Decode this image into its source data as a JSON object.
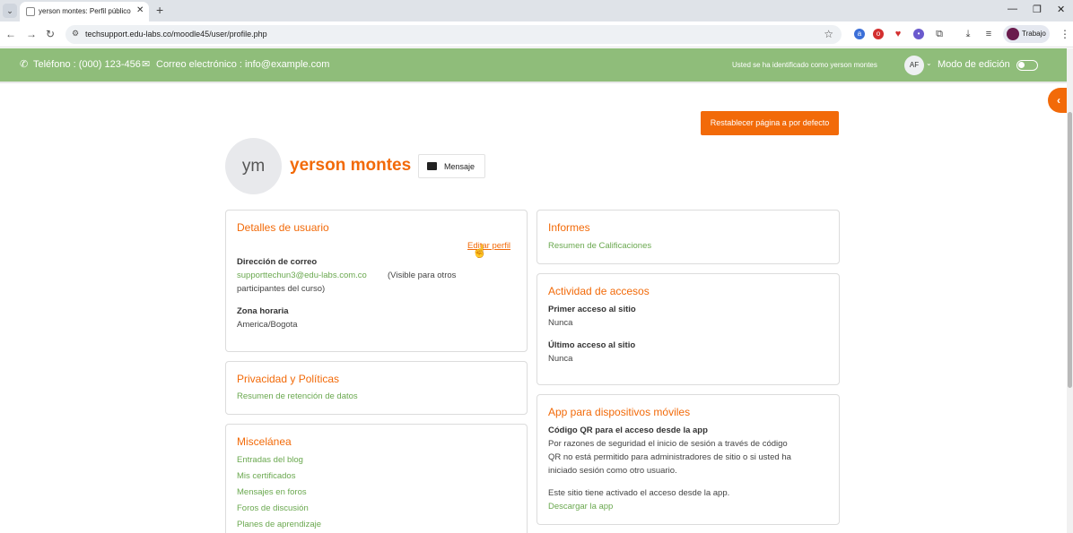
{
  "browser": {
    "tab_title": "yerson montes: Perfil público | T",
    "url": "techsupport.edu-labs.co/moodle45/user/profile.php",
    "profile_label": "Trabajo"
  },
  "header": {
    "phone": "Teléfono : (000) 123-456",
    "email": "Correo electrónico : info@example.com",
    "login_info": "Usted se ha identificado como yerson montes",
    "user_initials": "AF",
    "edit_mode_label": "Modo de edición"
  },
  "page": {
    "reset_button": "Restablecer página a por defecto",
    "avatar_initials": "ym",
    "profile_name": "yerson montes",
    "message_button": "Mensaje"
  },
  "user_details": {
    "title": "Detalles de usuario",
    "edit_link": "Editar perfil",
    "email_label": "Dirección de correo",
    "email_value": "supporttechun3@edu-labs.com.co",
    "email_note_line1": "(Visible para otros",
    "email_note_line2": "participantes del curso)",
    "timezone_label": "Zona horaria",
    "timezone_value": "America/Bogota"
  },
  "privacy": {
    "title": "Privacidad y Políticas",
    "link": "Resumen de retención de datos"
  },
  "misc": {
    "title": "Miscelánea",
    "items": [
      "Entradas del blog",
      "Mis certificados",
      "Mensajes en foros",
      "Foros de discusión",
      "Planes de aprendizaje"
    ]
  },
  "reports": {
    "title": "Informes",
    "link": "Resumen de Calificaciones"
  },
  "access": {
    "title": "Actividad de accesos",
    "first_label": "Primer acceso al sitio",
    "first_value": "Nunca",
    "last_label": "Último acceso al sitio",
    "last_value": "Nunca"
  },
  "mobile": {
    "title": "App para dispositivos móviles",
    "qr_label": "Código QR para el acceso desde la app",
    "qr_text_1": "Por razones de seguridad el inicio de sesión a través de código",
    "qr_text_2": "QR no está permitido para administradores de sitio o si usted ha",
    "qr_text_3": "iniciado sesión como otro usuario.",
    "app_enabled": "Este sitio tiene activado el acceso desde la app.",
    "download_link": "Descargar la app"
  }
}
